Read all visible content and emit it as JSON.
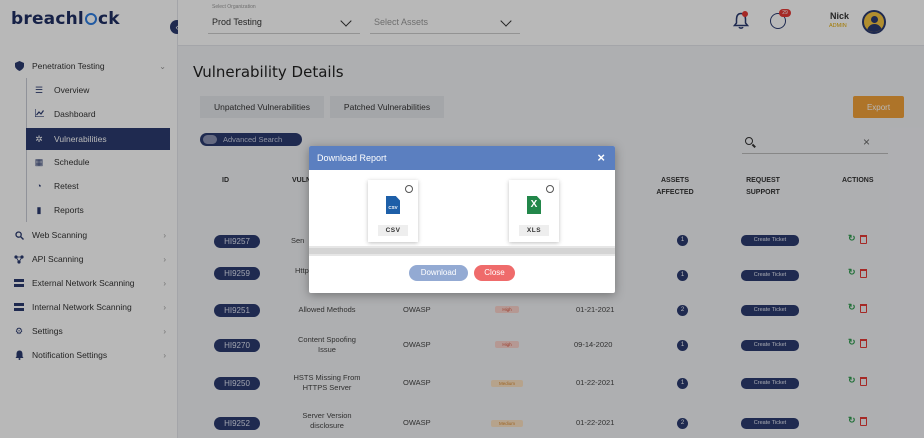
{
  "brand": {
    "logo_text_a": "breachl",
    "logo_text_b": "ck"
  },
  "sidebar": {
    "groups": [
      {
        "label": "Penetration Testing",
        "icon": "shield-icon"
      },
      {
        "label": "Web Scanning",
        "icon": "search-icon"
      },
      {
        "label": "API Scanning",
        "icon": "api-icon"
      },
      {
        "label": "External Network Scanning",
        "icon": "network-icon"
      },
      {
        "label": "Internal Network Scanning",
        "icon": "network-icon"
      },
      {
        "label": "Settings",
        "icon": "gear-icon"
      },
      {
        "label": "Notification Settings",
        "icon": "bell-icon"
      }
    ],
    "sub_items": [
      {
        "label": "Overview",
        "icon": "list-icon"
      },
      {
        "label": "Dashboard",
        "icon": "chart-icon"
      },
      {
        "label": "Vulnerabilities",
        "icon": "bug-icon",
        "active": true
      },
      {
        "label": "Schedule",
        "icon": "calendar-icon"
      },
      {
        "label": "Retest",
        "icon": "retest-icon"
      },
      {
        "label": "Reports",
        "icon": "report-icon"
      }
    ]
  },
  "header": {
    "org_label": "Select Organization",
    "org_value": "Prod Testing",
    "assets_placeholder": "Select Assets",
    "chat_badge": "29",
    "user_name": "Nick",
    "user_role": "ADMIN"
  },
  "main": {
    "title": "Vulnerability Details",
    "tabs": [
      "Unpatched Vulnerabilities",
      "Patched Vulnerabilities"
    ],
    "export_label": "Export",
    "advanced_search_label": "Advanced Search",
    "table_search_placeholder": "Search",
    "columns": {
      "id": "ID",
      "vuln": "VULN",
      "assets": [
        "ASSETS",
        "AFFECTED"
      ],
      "support": [
        "REQUEST",
        "SUPPORT"
      ],
      "actions": "ACTIONS"
    },
    "rows": [
      {
        "id": "HI9257",
        "name": [
          "Sen",
          ""
        ],
        "source": "",
        "severity": "",
        "date": "",
        "assets": "1",
        "ticket": "Create Ticket"
      },
      {
        "id": "HI9259",
        "name": [
          "Http",
          ""
        ],
        "source": "",
        "severity": "",
        "date": "",
        "assets": "1",
        "ticket": "Create Ticket"
      },
      {
        "id": "HI9251",
        "name": [
          "Allowed Methods",
          ""
        ],
        "source": "OWASP",
        "severity": "High",
        "sev_class": "high",
        "date": "01-21-2021",
        "assets": "2",
        "ticket": "Create Ticket"
      },
      {
        "id": "HI9270",
        "name": [
          "Content Spoofing",
          "Issue"
        ],
        "source": "OWASP",
        "severity": "High",
        "sev_class": "high",
        "date": "09-14-2020",
        "assets": "1",
        "ticket": "Create Ticket"
      },
      {
        "id": "HI9250",
        "name": [
          "HSTS Missing From",
          "HTTPS Server"
        ],
        "source": "OWASP",
        "severity": "Medium",
        "sev_class": "med",
        "date": "01-22-2021",
        "assets": "1",
        "ticket": "Create Ticket"
      },
      {
        "id": "HI9252",
        "name": [
          "Server Version",
          "disclosure"
        ],
        "source": "OWASP",
        "severity": "Medium",
        "sev_class": "med",
        "date": "01-22-2021",
        "assets": "2",
        "ticket": "Create Ticket"
      }
    ]
  },
  "modal": {
    "title": "Download Report",
    "options": [
      {
        "label": "CSV",
        "icon": "csv-file-icon",
        "glyph": "CSV"
      },
      {
        "label": "XLS",
        "icon": "excel-file-icon",
        "glyph": "X"
      }
    ],
    "download_label": "Download",
    "close_label": "Close"
  }
}
